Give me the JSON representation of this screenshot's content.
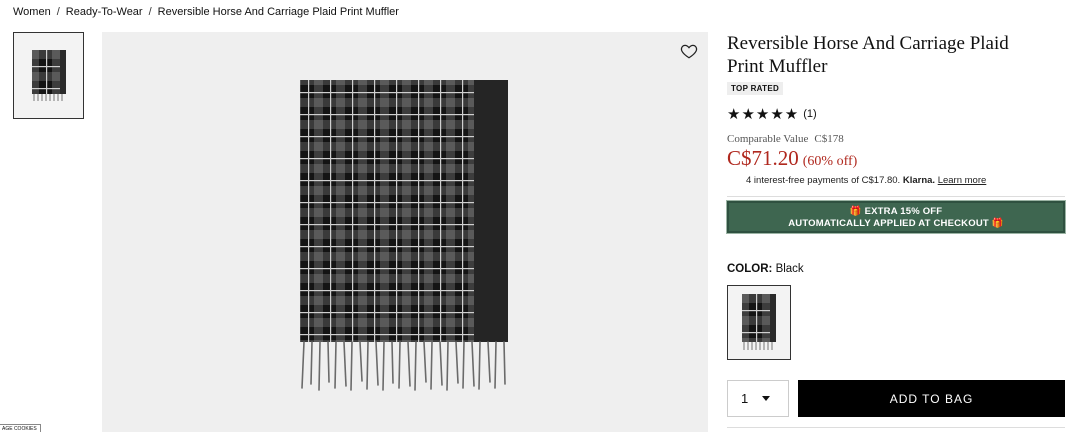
{
  "breadcrumb": [
    {
      "label": "Women"
    },
    {
      "label": "Ready-To-Wear"
    },
    {
      "label": "Reversible Horse And Carriage Plaid Print Muffler"
    }
  ],
  "breadcrumb_separator": "/",
  "product": {
    "title": "Reversible Horse And Carriage Plaid Print Muffler",
    "badge": "TOP RATED",
    "rating_stars": "★★★★★",
    "rating_value": 5,
    "review_count": "(1)",
    "comparable_label": "Comparable Value",
    "comparable_price": "C$178",
    "price": "C$71.20",
    "discount": "(60% off)",
    "klarna_text": "4 interest-free payments of C$17.80.",
    "klarna_brand": "Klarna.",
    "klarna_link": "Learn more",
    "promo_line1": "EXTRA 15% OFF",
    "promo_line2": "AUTOMATICALLY APPLIED AT CHECKOUT",
    "color_label": "COLOR:",
    "color_value": "Black",
    "quantity": "1",
    "add_to_bag": "ADD TO BAG"
  },
  "cookie_label": "AGE COOKIES",
  "icons": {
    "favorite": "heart-outline-icon",
    "gift": "gift-icon",
    "dropdown": "caret-down-icon"
  },
  "colors": {
    "price_red": "#b0281e",
    "promo_green": "#3e6650",
    "button_black": "#000000"
  }
}
